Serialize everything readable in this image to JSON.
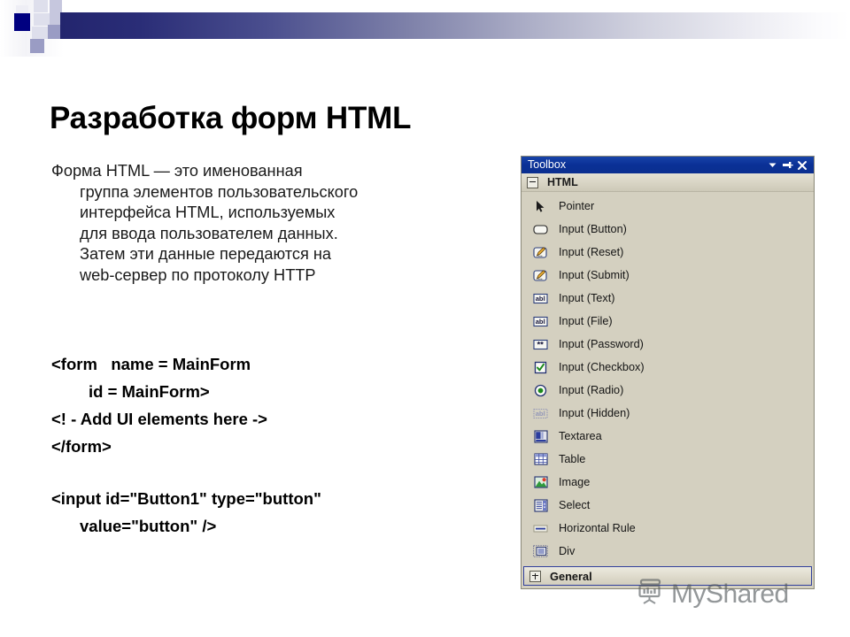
{
  "slide": {
    "title": "Разработка форм HTML",
    "paragraph_lines": [
      "Форма HTML — это именованная",
      "группа элементов пользовательского",
      "интерфейса HTML, используемых",
      "для ввода пользователем данных.",
      "Затем эти данные передаются на",
      "web-сервер по протоколу HTTP"
    ],
    "code_lines": [
      "<form   name = MainForm",
      "id = MainForm>",
      "<! - Add UI elements here ->",
      "</form>",
      "<input id=\"Button1\" type=\"button\"",
      "value=\"button\" />"
    ]
  },
  "toolbox": {
    "title": "Toolbox",
    "window_buttons": [
      {
        "name": "dropdown-icon",
        "glyph": "chevron-down"
      },
      {
        "name": "auto-hide-pin-icon",
        "glyph": "pin"
      },
      {
        "name": "close-icon",
        "glyph": "close"
      }
    ],
    "sections": {
      "html": {
        "label": "HTML",
        "state": "expanded",
        "toggle": "minus"
      },
      "general": {
        "label": "General",
        "state": "collapsed",
        "toggle": "plus"
      }
    },
    "items": [
      {
        "label": "Pointer",
        "icon": "pointer-arrow-icon"
      },
      {
        "label": "Input (Button)",
        "icon": "input-button-icon"
      },
      {
        "label": "Input (Reset)",
        "icon": "input-reset-pencil-icon"
      },
      {
        "label": "Input (Submit)",
        "icon": "input-submit-pencil-icon"
      },
      {
        "label": "Input (Text)",
        "icon": "input-text-abl-icon"
      },
      {
        "label": "Input (File)",
        "icon": "input-file-abl-icon"
      },
      {
        "label": "Input (Password)",
        "icon": "input-password-asterisk-icon"
      },
      {
        "label": "Input (Checkbox)",
        "icon": "input-checkbox-icon"
      },
      {
        "label": "Input (Radio)",
        "icon": "input-radio-icon"
      },
      {
        "label": "Input (Hidden)",
        "icon": "input-hidden-abl-icon"
      },
      {
        "label": "Textarea",
        "icon": "textarea-icon"
      },
      {
        "label": "Table",
        "icon": "table-grid-icon"
      },
      {
        "label": "Image",
        "icon": "image-picture-icon"
      },
      {
        "label": "Select",
        "icon": "select-dropdown-icon"
      },
      {
        "label": "Horizontal Rule",
        "icon": "horizontal-rule-icon"
      },
      {
        "label": "Div",
        "icon": "div-box-icon"
      }
    ]
  },
  "watermark": {
    "text": "MyShared",
    "icon": "projector-screen-icon"
  },
  "colors": {
    "banner_navy": "#000080",
    "titlebar_blue": "#0a3096",
    "panel_bg": "#d4d0c0",
    "selection_border": "#31409c",
    "text_black": "#000000"
  }
}
